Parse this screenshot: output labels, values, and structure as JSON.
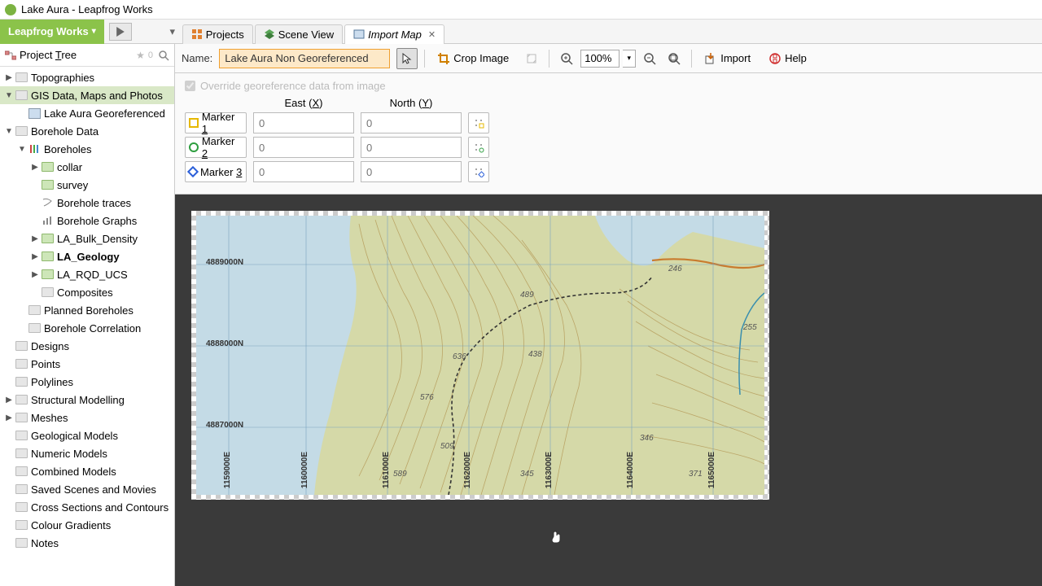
{
  "window": {
    "title": "Lake Aura - Leapfrog Works"
  },
  "brand": "Leapfrog Works",
  "tabs": [
    {
      "label": "Projects"
    },
    {
      "label": "Scene View"
    },
    {
      "label": "Import Map",
      "active": true,
      "closable": true
    }
  ],
  "sidebar": {
    "title": "Project Tree",
    "pin_count": "0",
    "items": [
      {
        "d": 0,
        "tw": "▶",
        "ic": "folder",
        "label": "Topographies"
      },
      {
        "d": 0,
        "tw": "▼",
        "ic": "folder",
        "label": "GIS Data, Maps and Photos",
        "sel": true
      },
      {
        "d": 1,
        "tw": "",
        "ic": "img",
        "label": "Lake Aura Georeferenced"
      },
      {
        "d": 0,
        "tw": "▼",
        "ic": "folder",
        "label": "Borehole Data"
      },
      {
        "d": 1,
        "tw": "▼",
        "ic": "cyl",
        "label": "Boreholes"
      },
      {
        "d": 2,
        "tw": "▶",
        "ic": "folderg",
        "label": "collar"
      },
      {
        "d": 2,
        "tw": "",
        "ic": "folderg",
        "label": "survey"
      },
      {
        "d": 2,
        "tw": "",
        "ic": "trace",
        "label": "Borehole traces"
      },
      {
        "d": 2,
        "tw": "",
        "ic": "graph",
        "label": "Borehole Graphs"
      },
      {
        "d": 2,
        "tw": "▶",
        "ic": "folderg",
        "label": "LA_Bulk_Density"
      },
      {
        "d": 2,
        "tw": "▶",
        "ic": "folderg",
        "label": "LA_Geology",
        "bold": true
      },
      {
        "d": 2,
        "tw": "▶",
        "ic": "folderg",
        "label": "LA_RQD_UCS"
      },
      {
        "d": 2,
        "tw": "",
        "ic": "folder",
        "label": "Composites"
      },
      {
        "d": 1,
        "tw": "",
        "ic": "folder",
        "label": "Planned Boreholes"
      },
      {
        "d": 1,
        "tw": "",
        "ic": "folder",
        "label": "Borehole Correlation"
      },
      {
        "d": 0,
        "tw": "",
        "ic": "folder",
        "label": "Designs"
      },
      {
        "d": 0,
        "tw": "",
        "ic": "folder",
        "label": "Points"
      },
      {
        "d": 0,
        "tw": "",
        "ic": "folder",
        "label": "Polylines"
      },
      {
        "d": 0,
        "tw": "▶",
        "ic": "folder",
        "label": "Structural Modelling"
      },
      {
        "d": 0,
        "tw": "▶",
        "ic": "folder",
        "label": "Meshes"
      },
      {
        "d": 0,
        "tw": "",
        "ic": "folder",
        "label": "Geological Models"
      },
      {
        "d": 0,
        "tw": "",
        "ic": "folder",
        "label": "Numeric Models"
      },
      {
        "d": 0,
        "tw": "",
        "ic": "folder",
        "label": "Combined Models"
      },
      {
        "d": 0,
        "tw": "",
        "ic": "folder",
        "label": "Saved Scenes and Movies"
      },
      {
        "d": 0,
        "tw": "",
        "ic": "folder",
        "label": "Cross Sections and Contours"
      },
      {
        "d": 0,
        "tw": "",
        "ic": "folder",
        "label": "Colour Gradients"
      },
      {
        "d": 0,
        "tw": "",
        "ic": "folder",
        "label": "Notes"
      }
    ]
  },
  "toolbar": {
    "name_label": "Name:",
    "name_value": "Lake Aura Non Georeferenced",
    "crop": "Crop Image",
    "zoom": "100%",
    "import": "Import",
    "help": "Help"
  },
  "georef": {
    "override": "Override georeference data from image",
    "east": "East (",
    "east_u": "X",
    "east_c": ")",
    "north": "North (",
    "north_u": "Y",
    "north_c": ")",
    "markers": [
      {
        "label": "Marker ",
        "u": "1",
        "east": "0",
        "north": "0"
      },
      {
        "label": "Marker ",
        "u": "2",
        "east": "0",
        "north": "0"
      },
      {
        "label": "Marker ",
        "u": "3",
        "east": "0",
        "north": "0"
      }
    ]
  },
  "map": {
    "y_labels": [
      "4889000N",
      "4888000N",
      "4887000N"
    ],
    "x_labels": [
      "1159000E",
      "1160000E",
      "1161000E",
      "1162000E",
      "1163000E",
      "1164000E",
      "1165000E"
    ],
    "spot": [
      "246",
      "489",
      "255",
      "438",
      "636",
      "576",
      "589",
      "509",
      "346",
      "345",
      "371"
    ]
  }
}
